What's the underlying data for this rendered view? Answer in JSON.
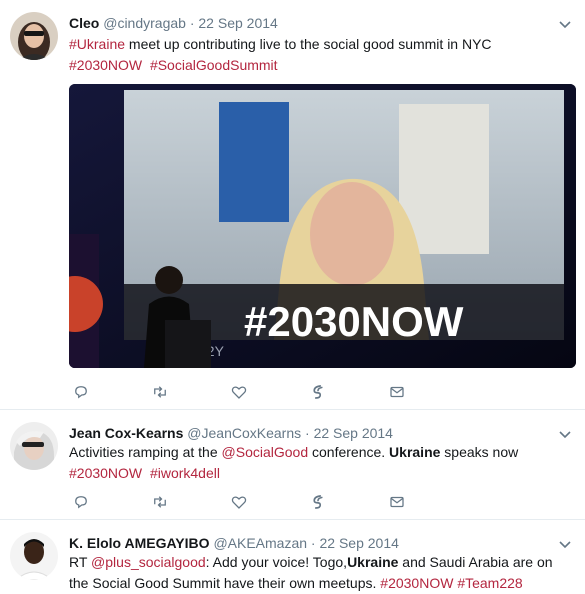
{
  "tweets": [
    {
      "name": "Cleo",
      "handle": "@cindyragab",
      "separator": "·",
      "date": "22 Sep 2014",
      "text": {
        "t1": "#Ukraine",
        "t2": " meet up contributing live to the social good summit in NYC",
        "t3": "#2030NOW",
        "t4": "#SocialGoodSummit"
      },
      "media": {
        "screen_text": "#2030NOW",
        "stage_text": "92Y"
      }
    },
    {
      "name": "Jean Cox-Kearns",
      "handle": "@JeanCoxKearns",
      "separator": "·",
      "date": "22 Sep 2014",
      "text": {
        "t1": "Activities ramping at the ",
        "t2": "@SocialGood",
        "t3": " conference. ",
        "t4": "Ukraine",
        "t5": " speaks now",
        "t6": "#2030NOW",
        "t7": "#iwork4dell"
      }
    },
    {
      "name": "K. Elolo AMEGAYIBO",
      "handle": "@AKEAmazan",
      "separator": "·",
      "date": "22 Sep 2014",
      "text": {
        "t1": "RT ",
        "t2": "@plus_socialgood",
        "t3": ": Add your voice! Togo,",
        "t4": "Ukraine",
        "t5": " and Saudi Arabia are on",
        "t6": "the Social Good Summit have their own meetups. ",
        "t7": "#2030NOW",
        "t8": "#Team228"
      }
    }
  ],
  "icons": {
    "reply": "reply-icon",
    "retweet": "retweet-icon",
    "like": "like-icon",
    "moments": "moments-icon",
    "message": "direct-message-icon",
    "caret": "chevron-down-icon"
  },
  "colors": {
    "hashtag": "#b3263f",
    "meta": "#657786",
    "icon": "#657786",
    "divider": "#e6ecf0"
  }
}
